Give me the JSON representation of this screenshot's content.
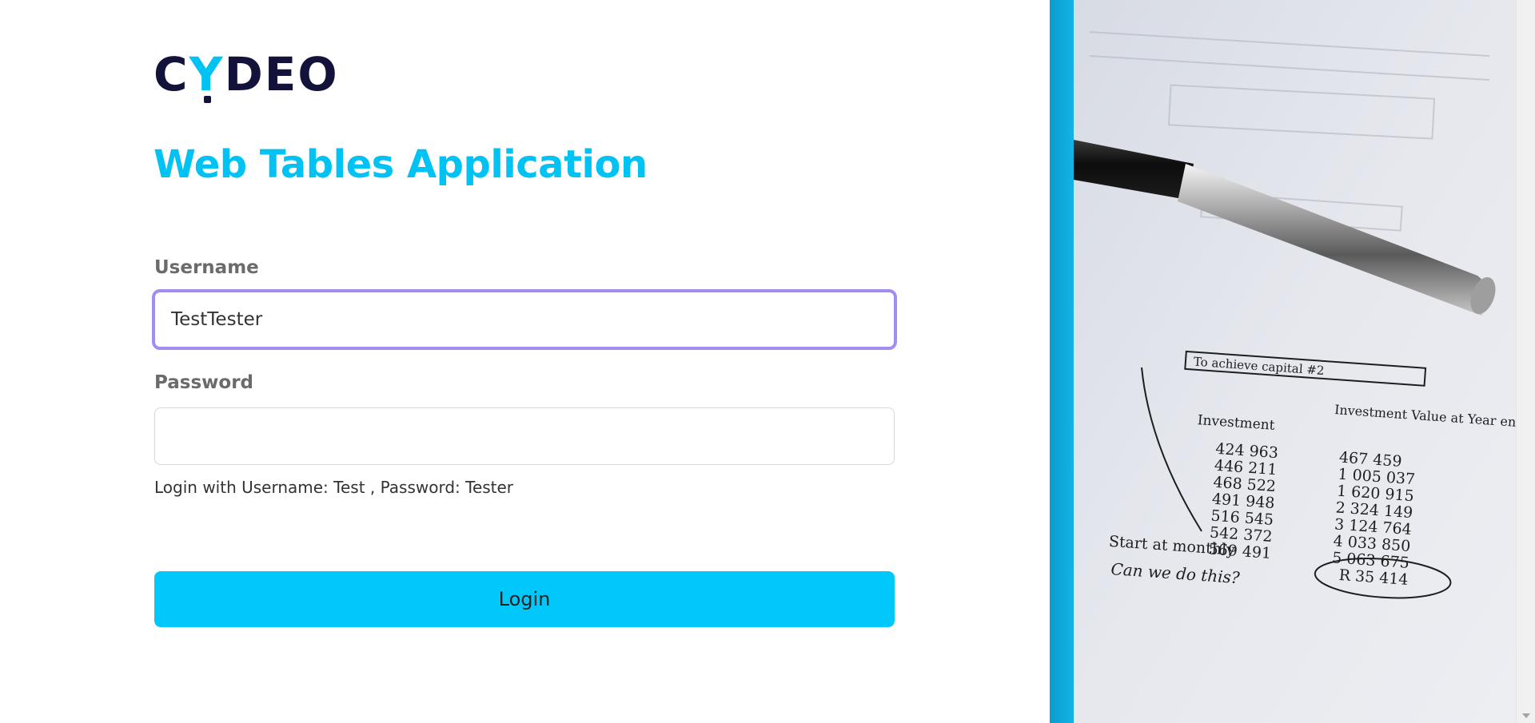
{
  "brand": {
    "logo_text_pre": "C",
    "logo_text_y": "Y",
    "logo_text_post": "DEO",
    "primary_color": "#00c2f3",
    "dark_color": "#12123a"
  },
  "login_form": {
    "title": "Web Tables Application",
    "username_label": "Username",
    "username_value": "TestTester",
    "password_label": "Password",
    "password_value": "",
    "hint": "Login with Username: Test , Password: Tester",
    "login_label": "Login",
    "focus_ring_color": "#a48df0",
    "button_color": "#00c8fb"
  },
  "photo": {
    "table_header_box": "To achieve capital #2",
    "col1_header": "Investment",
    "col2_header": "Investment Value at Year end",
    "col1_values": [
      "424 963",
      "446 211",
      "468 522",
      "491 948",
      "516 545",
      "542 372",
      "569 491"
    ],
    "col2_values": [
      "467 459",
      "1 005 037",
      "1 620 915",
      "2 324 149",
      "3 124 764",
      "4 033 850",
      "5 063 675"
    ],
    "note_line1": "Start at monthly",
    "circled_value": "R 35 414",
    "note_line2": "Can we do this?"
  }
}
